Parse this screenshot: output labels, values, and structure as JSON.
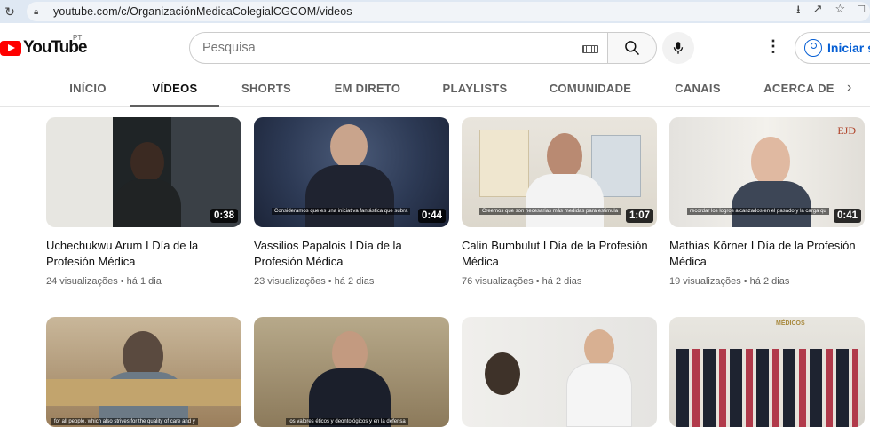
{
  "browser": {
    "url": "youtube.com/c/OrganizaciónMedicaColegialCGCOM/videos"
  },
  "masthead": {
    "logo_text": "YouTube",
    "region": "PT",
    "search_placeholder": "Pesquisa",
    "signin_label": "Iniciar se"
  },
  "tabs": [
    {
      "label": "INÍCIO"
    },
    {
      "label": "VÍDEOS",
      "active": true
    },
    {
      "label": "SHORTS"
    },
    {
      "label": "EM DIRETO"
    },
    {
      "label": "PLAYLISTS"
    },
    {
      "label": "COMUNIDADE"
    },
    {
      "label": "CANAIS"
    },
    {
      "label": "ACERCA DE"
    }
  ],
  "videos": [
    {
      "title": "Uchechukwu Arum I Día de la Profesión Médica",
      "meta": "24 visualizações • há 1 dia",
      "duration": "0:38",
      "caption": ""
    },
    {
      "title": "Vassilios Papalois I Día de la Profesión Médica",
      "meta": "23 visualizações • há 2 dias",
      "duration": "0:44",
      "caption": "Consideramos que es una iniciativa fantástica que subra"
    },
    {
      "title": "Calin Bumbulut I Día de la Profesión Médica",
      "meta": "76 visualizações • há 2 dias",
      "duration": "1:07",
      "caption": "Creemos que son necesarias más medidas para estimula"
    },
    {
      "title": "Mathias Körner I Día de la Profesión Médica",
      "meta": "19 visualizações • há 2 dias",
      "duration": "0:41",
      "caption": "recordar los logros alcanzados en el pasado y la carga qu"
    },
    {
      "title": "",
      "meta": "",
      "duration": "",
      "caption": "for all people, which also strives for the quality of care and y"
    },
    {
      "title": "",
      "meta": "",
      "duration": "",
      "caption": "los valores éticos y deontológicos y en la defensa"
    },
    {
      "title": "",
      "meta": "",
      "duration": "",
      "caption": ""
    },
    {
      "title": "",
      "meta": "",
      "duration": "",
      "caption": ""
    }
  ],
  "thumb_logos": {
    "ejd": "EJD",
    "medicos": "MÉDICOS"
  },
  "colors": {
    "brand_red": "#ff0000",
    "link_blue": "#065fd4",
    "meta_gray": "#606060"
  },
  "icons": [
    "reload-icon",
    "lock-icon",
    "search-icon",
    "mic-icon",
    "keyboard-icon",
    "more-vert-icon",
    "account-icon",
    "chevron-right-icon"
  ]
}
